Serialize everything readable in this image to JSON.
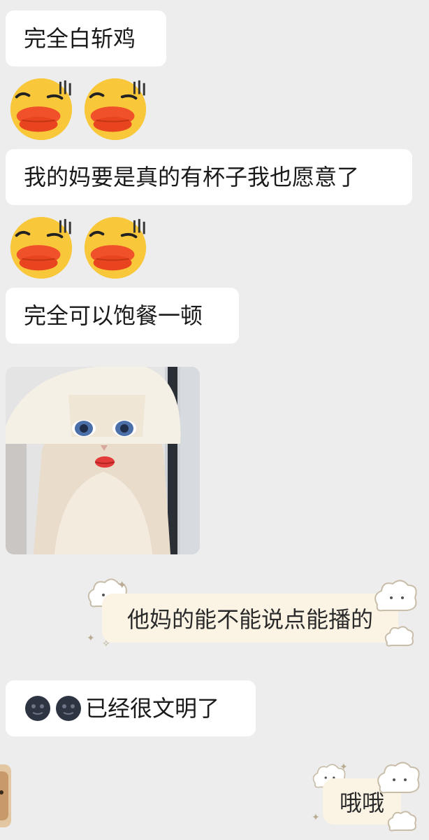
{
  "messages": [
    {
      "side": "left",
      "type": "text",
      "text": "完全白斩鸡"
    },
    {
      "side": "left",
      "type": "stickers",
      "sticker": "duck-lips-emoji",
      "count": 2
    },
    {
      "side": "left",
      "type": "text",
      "text": "我的妈要是真的有杯子我也愿意了"
    },
    {
      "side": "left",
      "type": "stickers",
      "sticker": "duck-lips-emoji",
      "count": 2
    },
    {
      "side": "left",
      "type": "text",
      "text": "完全可以饱餐一顿"
    },
    {
      "side": "left",
      "type": "image",
      "image": "cat-with-lipstick-photo"
    },
    {
      "side": "right",
      "type": "text",
      "text": "他妈的能不能说点能播的"
    },
    {
      "side": "left",
      "type": "text",
      "icon": "moon-face-emoji",
      "text": "已经很文明了"
    },
    {
      "side": "right",
      "type": "text",
      "text": "哦哦"
    }
  ],
  "colors": {
    "background": "#ededed",
    "incoming_bubble": "#ffffff",
    "outgoing_bubble": "#fbf4e5",
    "text": "#1a1a1a"
  }
}
